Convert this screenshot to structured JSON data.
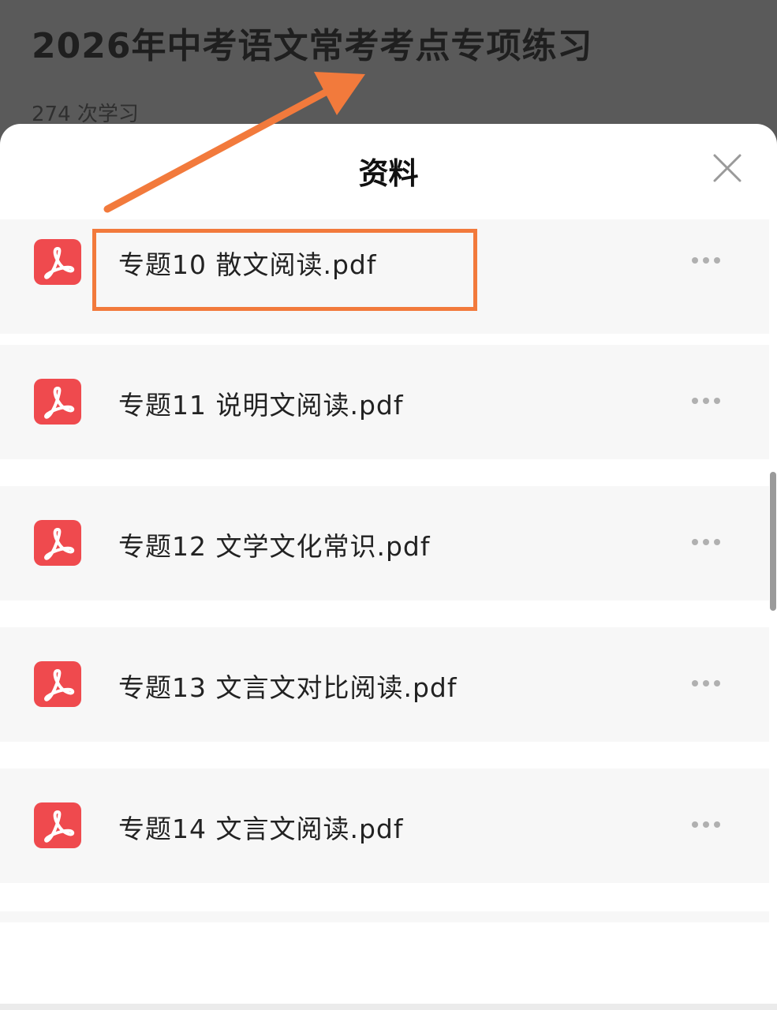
{
  "course": {
    "title": "2026年中考语文常考考点专项练习",
    "study_count": "274 次学习"
  },
  "sheet": {
    "title": "资料",
    "close_icon": "close-icon"
  },
  "files": [
    {
      "name": "专题10 散文阅读.pdf",
      "icon": "pdf-icon",
      "highlighted": true
    },
    {
      "name": "专题11 说明文阅读.pdf",
      "icon": "pdf-icon",
      "highlighted": false
    },
    {
      "name": "专题12 文学文化常识.pdf",
      "icon": "pdf-icon",
      "highlighted": false
    },
    {
      "name": "专题13 文言文对比阅读.pdf",
      "icon": "pdf-icon",
      "highlighted": false
    },
    {
      "name": "专题14 文言文阅读.pdf",
      "icon": "pdf-icon",
      "highlighted": false
    }
  ],
  "colors": {
    "pdf_icon": "#ef4a4e",
    "annotation": "#f27a3c",
    "backdrop": "#5a5a5a"
  }
}
